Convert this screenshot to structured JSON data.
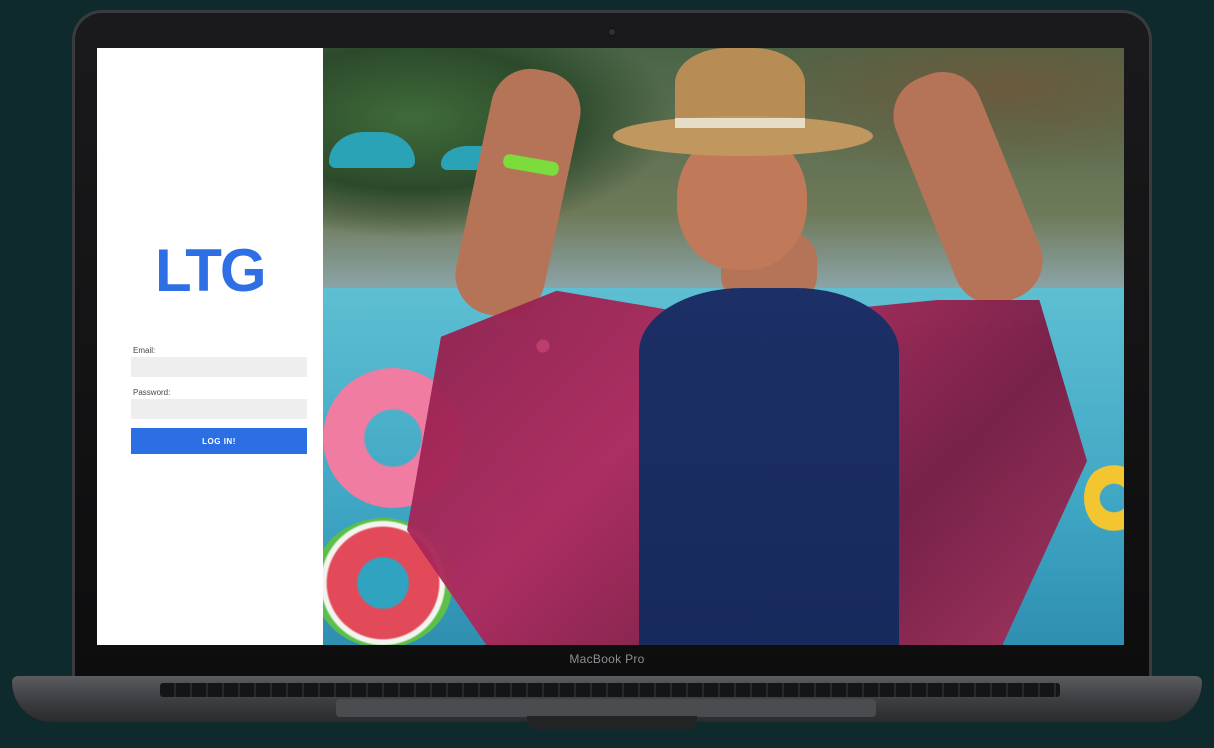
{
  "device": {
    "model_label": "MacBook Pro"
  },
  "login": {
    "logo_text": "LTG",
    "email_label": "Email:",
    "email_value": "",
    "password_label": "Password:",
    "password_value": "",
    "submit_label": "LOG IN!"
  },
  "colors": {
    "brand": "#2f6fe6",
    "button": "#2c6fe4",
    "field_bg": "#eeeeee",
    "page_bg": "#0f2a2c"
  }
}
